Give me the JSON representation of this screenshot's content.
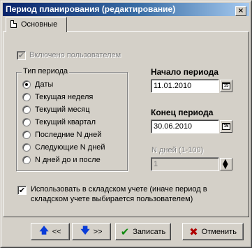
{
  "window": {
    "title": "Период планирования (редактирование)",
    "close_glyph": "×"
  },
  "tabs": [
    {
      "label": "Основные"
    }
  ],
  "enabled_by_user": {
    "label": "Включено пользователем",
    "checked": true,
    "disabled": true
  },
  "period_type": {
    "title": "Тип периода",
    "options": [
      {
        "label": "Даты",
        "selected": true
      },
      {
        "label": "Текущая неделя",
        "selected": false
      },
      {
        "label": "Текущий месяц",
        "selected": false
      },
      {
        "label": "Текущий квартал",
        "selected": false
      },
      {
        "label": "Последние N дней",
        "selected": false
      },
      {
        "label": "Следующие N дней",
        "selected": false
      },
      {
        "label": "N дней до и после",
        "selected": false
      }
    ]
  },
  "period_start": {
    "label": "Начало периода",
    "value": "11.01.2010",
    "calendar_icon_text": "15"
  },
  "period_end": {
    "label": "Конец периода",
    "value": "30.06.2010",
    "calendar_icon_text": "15"
  },
  "n_days": {
    "label": "N дней (1-100)",
    "value": "1",
    "disabled": true
  },
  "warehouse": {
    "label_line1": "Использовать в складском учете (иначе период в",
    "label_line2": "складском учете выбирается пользователем)",
    "checked": true
  },
  "buttons": {
    "prev_label": "<<",
    "next_label": ">>",
    "save_label": "Записать",
    "cancel_label": "Отменить"
  },
  "icons": {
    "up_arrow": "🡅",
    "down_arrow": "🡇",
    "check": "✔",
    "cross": "✖",
    "checkmark": "✔"
  },
  "colors": {
    "title_bar_start": "#0a246a",
    "title_bar_end": "#a6caf0",
    "face": "#d4d0c8"
  }
}
